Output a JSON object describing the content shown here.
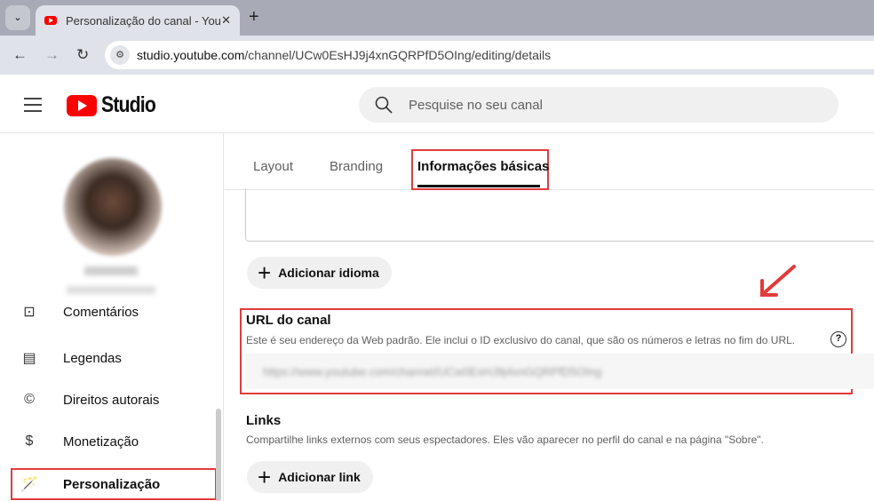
{
  "browser": {
    "tab_title": "Personalização do canal - YouTube",
    "url_host": "studio.youtube.com",
    "url_path": "/channel/UCw0EsHJ9j4xnGQRPfD5OIng/editing/details"
  },
  "header": {
    "logo_text": "Studio",
    "search_placeholder": "Pesquise no seu canal"
  },
  "sidebar": {
    "items": [
      {
        "label": "Comentários",
        "icon": "comment-icon"
      },
      {
        "label": "Legendas",
        "icon": "subtitles-icon"
      },
      {
        "label": "Direitos autorais",
        "icon": "copyright-icon"
      },
      {
        "label": "Monetização",
        "icon": "dollar-icon"
      },
      {
        "label": "Personalização",
        "icon": "magic-wand-icon"
      }
    ]
  },
  "tabs": [
    "Layout",
    "Branding",
    "Informações básicas"
  ],
  "content": {
    "add_language": "Adicionar idioma",
    "url_title": "URL do canal",
    "url_desc": "Este é seu endereço da Web padrão. Ele inclui o ID exclusivo do canal, que são os números e letras no fim do URL.",
    "url_value": "https://www.youtube.com/channel/UCw0EsHJ9j4xnGQRPfD5OIng",
    "links_title": "Links",
    "links_desc": "Compartilhe links externos com seus espectadores. Eles vão aparecer no perfil do canal e na página \"Sobre\".",
    "add_link": "Adicionar link"
  }
}
